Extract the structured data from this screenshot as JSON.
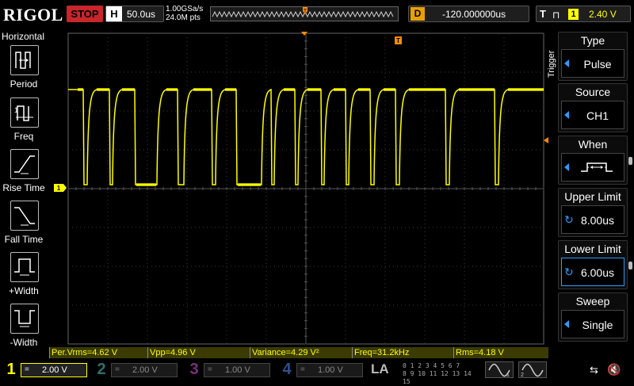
{
  "topbar": {
    "logo": "RIGOL",
    "run_state": "STOP",
    "timebase_key": "H",
    "timebase_value": "50.0us",
    "sample_rate": "1.00GSa/s",
    "memory_depth": "24.0M pts",
    "delay_key": "D",
    "delay_value": "-120.000000us",
    "trigger_key": "T",
    "trigger_channel": "1",
    "trigger_level": "2.40 V"
  },
  "left_menu": {
    "title": "Horizontal",
    "items": [
      {
        "label": "Period",
        "icon": "period-icon"
      },
      {
        "label": "Freq",
        "icon": "freq-icon"
      },
      {
        "label": "Rise Time",
        "icon": "rise-time-icon"
      },
      {
        "label": "Fall Time",
        "icon": "fall-time-icon"
      },
      {
        "label": "+Width",
        "icon": "positive-width-icon"
      },
      {
        "label": "-Width",
        "icon": "negative-width-icon"
      }
    ]
  },
  "right_menu": {
    "group_label": "Trigger",
    "items": [
      {
        "title": "Type",
        "value": "Pulse",
        "active": false
      },
      {
        "title": "Source",
        "value": "CH1",
        "active": false
      },
      {
        "title": "When",
        "value": "",
        "active": false
      },
      {
        "title": "Upper Limit",
        "value": "8.00us",
        "active": false
      },
      {
        "title": "Lower Limit",
        "value": "6.00us",
        "active": true
      },
      {
        "title": "Sweep",
        "value": "Single",
        "active": false
      }
    ]
  },
  "measurements": [
    {
      "label": "Per.Vrms=4.62 V"
    },
    {
      "label": "Vpp=4.96 V"
    },
    {
      "label": "Variance=4.29 V²"
    },
    {
      "label": "Freq=31.2kHz"
    },
    {
      "label": "Rms=4.18 V"
    }
  ],
  "channels": [
    {
      "num": "1",
      "coupling": "=",
      "scale": "2.00 V",
      "color": "#ffff00",
      "active": true
    },
    {
      "num": "2",
      "coupling": "=",
      "scale": "2.00 V",
      "color": "#00ffff",
      "active": false
    },
    {
      "num": "3",
      "coupling": "=",
      "scale": "1.00 V",
      "color": "#ff33ff",
      "active": false
    },
    {
      "num": "4",
      "coupling": "=",
      "scale": "1.00 V",
      "color": "#3399ff",
      "active": false
    }
  ],
  "la_label": "LA",
  "digital_rows": [
    "0 1 2 3  4 5 6 7",
    "8 9 10 11  12 13 14 15"
  ],
  "colors": {
    "ch1": "#ffff00",
    "trigger": "#ff8c00",
    "accent": "#2a9cff"
  }
}
